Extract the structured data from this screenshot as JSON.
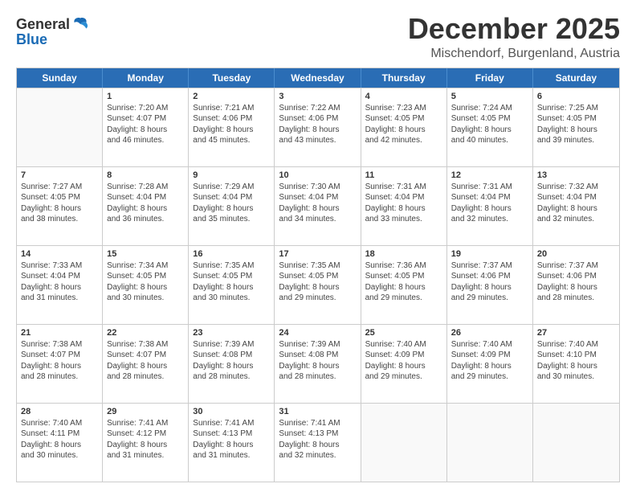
{
  "header": {
    "logo_general": "General",
    "logo_blue": "Blue",
    "month": "December 2025",
    "location": "Mischendorf, Burgenland, Austria"
  },
  "weekdays": [
    "Sunday",
    "Monday",
    "Tuesday",
    "Wednesday",
    "Thursday",
    "Friday",
    "Saturday"
  ],
  "rows": [
    [
      {
        "day": "",
        "detail": ""
      },
      {
        "day": "1",
        "detail": "Sunrise: 7:20 AM\nSunset: 4:07 PM\nDaylight: 8 hours\nand 46 minutes."
      },
      {
        "day": "2",
        "detail": "Sunrise: 7:21 AM\nSunset: 4:06 PM\nDaylight: 8 hours\nand 45 minutes."
      },
      {
        "day": "3",
        "detail": "Sunrise: 7:22 AM\nSunset: 4:06 PM\nDaylight: 8 hours\nand 43 minutes."
      },
      {
        "day": "4",
        "detail": "Sunrise: 7:23 AM\nSunset: 4:05 PM\nDaylight: 8 hours\nand 42 minutes."
      },
      {
        "day": "5",
        "detail": "Sunrise: 7:24 AM\nSunset: 4:05 PM\nDaylight: 8 hours\nand 40 minutes."
      },
      {
        "day": "6",
        "detail": "Sunrise: 7:25 AM\nSunset: 4:05 PM\nDaylight: 8 hours\nand 39 minutes."
      }
    ],
    [
      {
        "day": "7",
        "detail": "Sunrise: 7:27 AM\nSunset: 4:05 PM\nDaylight: 8 hours\nand 38 minutes."
      },
      {
        "day": "8",
        "detail": "Sunrise: 7:28 AM\nSunset: 4:04 PM\nDaylight: 8 hours\nand 36 minutes."
      },
      {
        "day": "9",
        "detail": "Sunrise: 7:29 AM\nSunset: 4:04 PM\nDaylight: 8 hours\nand 35 minutes."
      },
      {
        "day": "10",
        "detail": "Sunrise: 7:30 AM\nSunset: 4:04 PM\nDaylight: 8 hours\nand 34 minutes."
      },
      {
        "day": "11",
        "detail": "Sunrise: 7:31 AM\nSunset: 4:04 PM\nDaylight: 8 hours\nand 33 minutes."
      },
      {
        "day": "12",
        "detail": "Sunrise: 7:31 AM\nSunset: 4:04 PM\nDaylight: 8 hours\nand 32 minutes."
      },
      {
        "day": "13",
        "detail": "Sunrise: 7:32 AM\nSunset: 4:04 PM\nDaylight: 8 hours\nand 32 minutes."
      }
    ],
    [
      {
        "day": "14",
        "detail": "Sunrise: 7:33 AM\nSunset: 4:04 PM\nDaylight: 8 hours\nand 31 minutes."
      },
      {
        "day": "15",
        "detail": "Sunrise: 7:34 AM\nSunset: 4:05 PM\nDaylight: 8 hours\nand 30 minutes."
      },
      {
        "day": "16",
        "detail": "Sunrise: 7:35 AM\nSunset: 4:05 PM\nDaylight: 8 hours\nand 30 minutes."
      },
      {
        "day": "17",
        "detail": "Sunrise: 7:35 AM\nSunset: 4:05 PM\nDaylight: 8 hours\nand 29 minutes."
      },
      {
        "day": "18",
        "detail": "Sunrise: 7:36 AM\nSunset: 4:05 PM\nDaylight: 8 hours\nand 29 minutes."
      },
      {
        "day": "19",
        "detail": "Sunrise: 7:37 AM\nSunset: 4:06 PM\nDaylight: 8 hours\nand 29 minutes."
      },
      {
        "day": "20",
        "detail": "Sunrise: 7:37 AM\nSunset: 4:06 PM\nDaylight: 8 hours\nand 28 minutes."
      }
    ],
    [
      {
        "day": "21",
        "detail": "Sunrise: 7:38 AM\nSunset: 4:07 PM\nDaylight: 8 hours\nand 28 minutes."
      },
      {
        "day": "22",
        "detail": "Sunrise: 7:38 AM\nSunset: 4:07 PM\nDaylight: 8 hours\nand 28 minutes."
      },
      {
        "day": "23",
        "detail": "Sunrise: 7:39 AM\nSunset: 4:08 PM\nDaylight: 8 hours\nand 28 minutes."
      },
      {
        "day": "24",
        "detail": "Sunrise: 7:39 AM\nSunset: 4:08 PM\nDaylight: 8 hours\nand 28 minutes."
      },
      {
        "day": "25",
        "detail": "Sunrise: 7:40 AM\nSunset: 4:09 PM\nDaylight: 8 hours\nand 29 minutes."
      },
      {
        "day": "26",
        "detail": "Sunrise: 7:40 AM\nSunset: 4:09 PM\nDaylight: 8 hours\nand 29 minutes."
      },
      {
        "day": "27",
        "detail": "Sunrise: 7:40 AM\nSunset: 4:10 PM\nDaylight: 8 hours\nand 30 minutes."
      }
    ],
    [
      {
        "day": "28",
        "detail": "Sunrise: 7:40 AM\nSunset: 4:11 PM\nDaylight: 8 hours\nand 30 minutes."
      },
      {
        "day": "29",
        "detail": "Sunrise: 7:41 AM\nSunset: 4:12 PM\nDaylight: 8 hours\nand 31 minutes."
      },
      {
        "day": "30",
        "detail": "Sunrise: 7:41 AM\nSunset: 4:13 PM\nDaylight: 8 hours\nand 31 minutes."
      },
      {
        "day": "31",
        "detail": "Sunrise: 7:41 AM\nSunset: 4:13 PM\nDaylight: 8 hours\nand 32 minutes."
      },
      {
        "day": "",
        "detail": ""
      },
      {
        "day": "",
        "detail": ""
      },
      {
        "day": "",
        "detail": ""
      }
    ]
  ]
}
